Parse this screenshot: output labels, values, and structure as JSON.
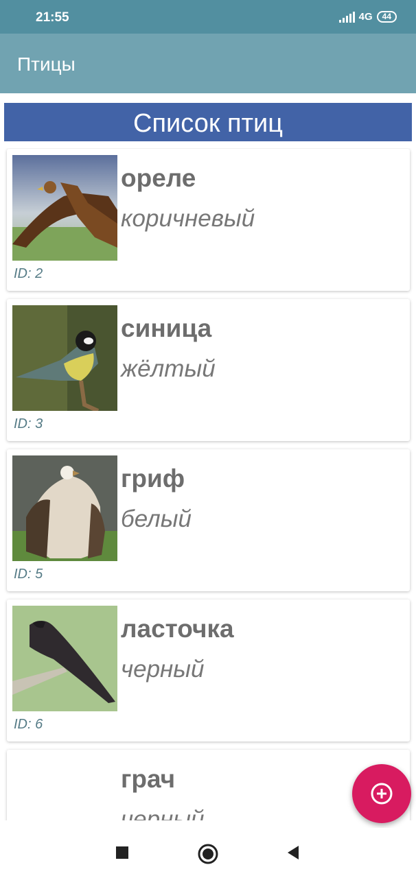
{
  "status_bar": {
    "time": "21:55",
    "network": "4G",
    "battery": "44"
  },
  "app_bar": {
    "title": "Птицы"
  },
  "list_header": "Список птиц",
  "birds": [
    {
      "name": "ореле",
      "color": "коричневый",
      "id": "ID: 2",
      "icon": "eagle-photo"
    },
    {
      "name": "синица",
      "color": "жёлтый",
      "id": "ID: 3",
      "icon": "tit-photo"
    },
    {
      "name": "гриф",
      "color": "белый",
      "id": "ID: 5",
      "icon": "vulture-photo"
    },
    {
      "name": "ласточка",
      "color": "черный",
      "id": "ID: 6",
      "icon": "swallow-photo"
    },
    {
      "name": "грач",
      "color": "черный",
      "id": "",
      "icon": ""
    }
  ],
  "fab": {
    "icon": "add-circle-icon"
  },
  "nav_bar": {
    "icons": [
      "recent-apps-icon",
      "home-icon",
      "back-icon"
    ]
  }
}
